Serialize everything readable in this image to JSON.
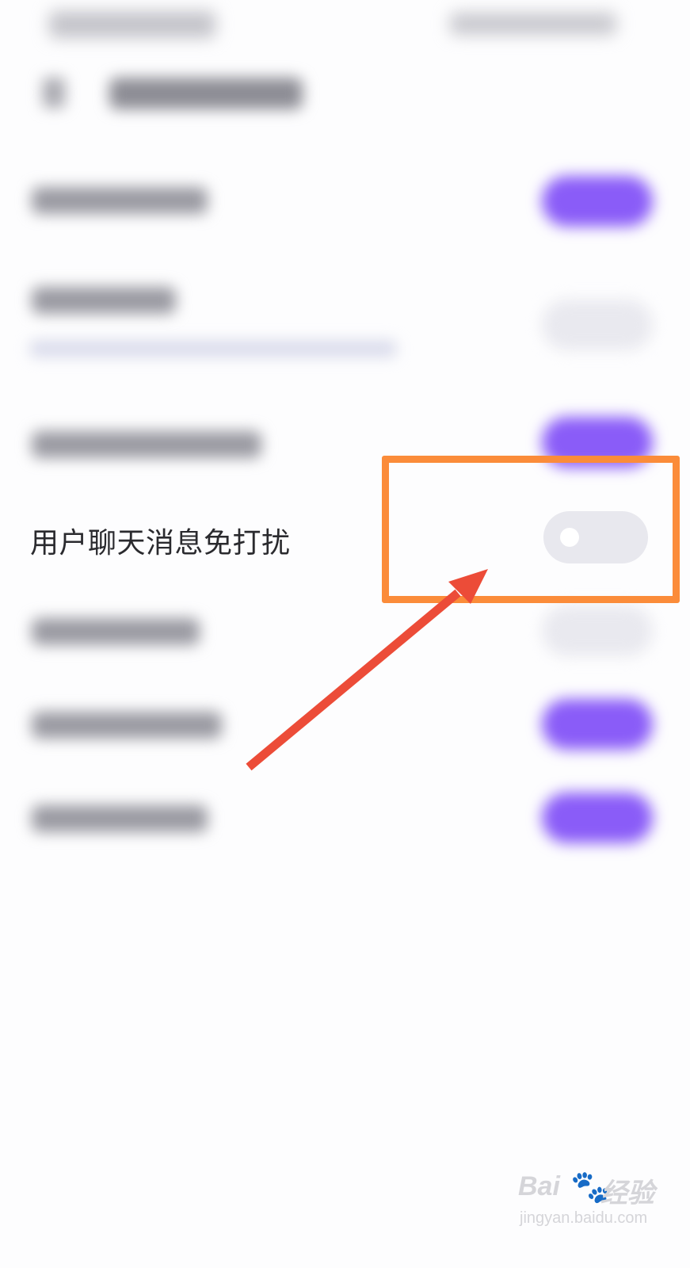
{
  "setting": {
    "label": "用户聊天消息免打扰",
    "toggle_state": "off"
  },
  "watermark": {
    "brand": "Bai",
    "suffix": "经验",
    "url": "jingyan.baidu.com"
  },
  "colors": {
    "accent_toggle_on": "#8a5cf8",
    "toggle_off": "#e8e8ee",
    "highlight_box": "#fb8c3a",
    "arrow": "#ec4c38"
  }
}
